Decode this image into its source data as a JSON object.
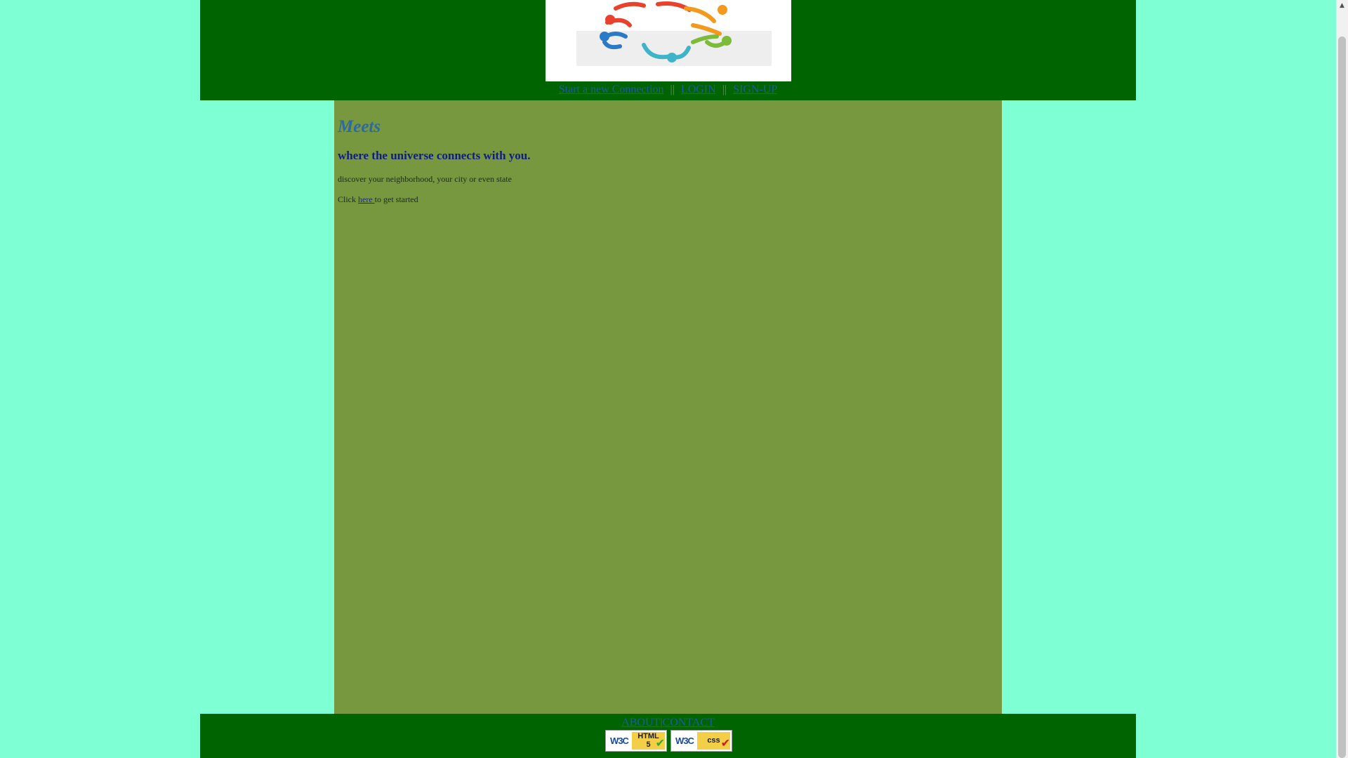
{
  "header": {
    "logo_alt": "people connected in a circle logo",
    "nav": [
      {
        "label": "Start a new Connection"
      },
      {
        "label": "LOGIN"
      },
      {
        "label": "SIGN-UP"
      }
    ],
    "separator": "||"
  },
  "main": {
    "title": "Meets",
    "tagline": "where the universe connects with you.",
    "description": "discover your neighborhood, your city or even state",
    "cta_prefix": "Click ",
    "cta_link": "here ",
    "cta_suffix": "to get started"
  },
  "footer": {
    "nav": [
      {
        "label": "ABOUT"
      },
      {
        "label": "CONTACT"
      }
    ],
    "separator": "|",
    "badges": [
      {
        "w3c": "W3C",
        "tag_line1": "HTML",
        "tag_line2": "5"
      },
      {
        "w3c": "W3C",
        "tag_line1": "css",
        "tag_line2": ""
      }
    ]
  },
  "colors": {
    "page_background": "#7fffd4",
    "header_footer": "#006400",
    "content_background": "#77983f",
    "title": "#2e6aa0",
    "tagline": "#0f1c8a"
  },
  "icons": [
    "logo-people-circle",
    "checkmark-icon"
  ]
}
